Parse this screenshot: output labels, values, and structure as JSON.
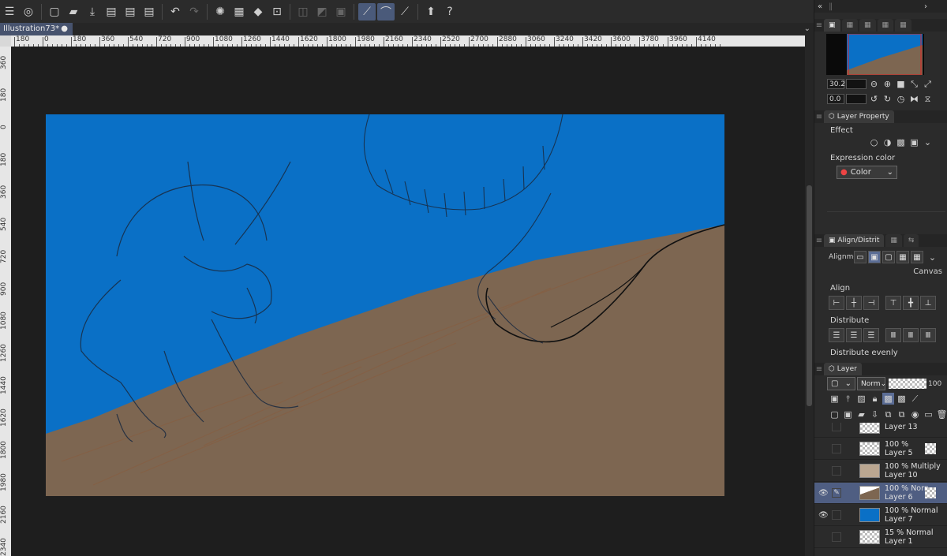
{
  "document": {
    "tab_title": "Illustration73*",
    "modified_mark": "●"
  },
  "toolbar": {
    "icons": [
      "menu-icon",
      "app-logo-icon",
      "new-icon",
      "open-icon",
      "save-icon",
      "export-jpg-icon",
      "export-png-icon",
      "export-psd-icon",
      "undo-icon",
      "redo-icon",
      "clear-selection-icon",
      "fill-selection-icon",
      "fill-icon",
      "transform-icon",
      "crop-icon",
      "invert-icon",
      "selection-mask-icon",
      "snap-ruler-icon",
      "snap-special-icon",
      "snap-grid-icon",
      "upgrade-icon",
      "help-icon"
    ]
  },
  "ruler": {
    "top_labels": [
      "180",
      "0",
      "180",
      "360",
      "540",
      "720",
      "900",
      "1080",
      "1260",
      "1440",
      "1620",
      "1800",
      "1980",
      "2160",
      "2340",
      "2520",
      "2700",
      "2880",
      "3060",
      "3240",
      "3420",
      "3600",
      "3780",
      "3960",
      "4140"
    ],
    "left_labels": [
      "360",
      "180",
      "0",
      "180",
      "360",
      "540",
      "720",
      "900",
      "1080",
      "1260",
      "1440",
      "1620",
      "1800",
      "1980",
      "2160",
      "2340"
    ]
  },
  "colors": {
    "sky": "#0a70c6",
    "ground": "#7d6651",
    "selected_layer": "#4f5e82",
    "panel": "#2b2b2b"
  },
  "navigator": {
    "zoom": "30.2",
    "rotation": "0.0"
  },
  "layer_property": {
    "tab": "Layer Property",
    "effect_label": "Effect",
    "expression_color_label": "Expression color",
    "expression_color_value": "Color"
  },
  "align": {
    "tab": "Align/Distrit",
    "alignment_label": "Alignme",
    "target": "Canvas",
    "align_label": "Align",
    "distribute_label": "Distribute",
    "distribute_evenly_label": "Distribute evenly"
  },
  "layers": {
    "tab": "Layer",
    "blend_mode": "Norm",
    "opacity": "100",
    "items": [
      {
        "name": "Layer 13",
        "mode": "",
        "visible": false,
        "selected": false
      },
      {
        "name": "Layer 5",
        "mode": "100 %",
        "visible": false,
        "selected": false
      },
      {
        "name": "Layer 10",
        "mode": "100 % Multiply",
        "visible": false,
        "selected": false
      },
      {
        "name": "Layer 6",
        "mode": "100 % Norn",
        "visible": true,
        "selected": true
      },
      {
        "name": "Layer 7",
        "mode": "100 % Normal",
        "visible": true,
        "selected": false
      },
      {
        "name": "Layer 1",
        "mode": "15 % Normal",
        "visible": false,
        "selected": false
      }
    ]
  }
}
